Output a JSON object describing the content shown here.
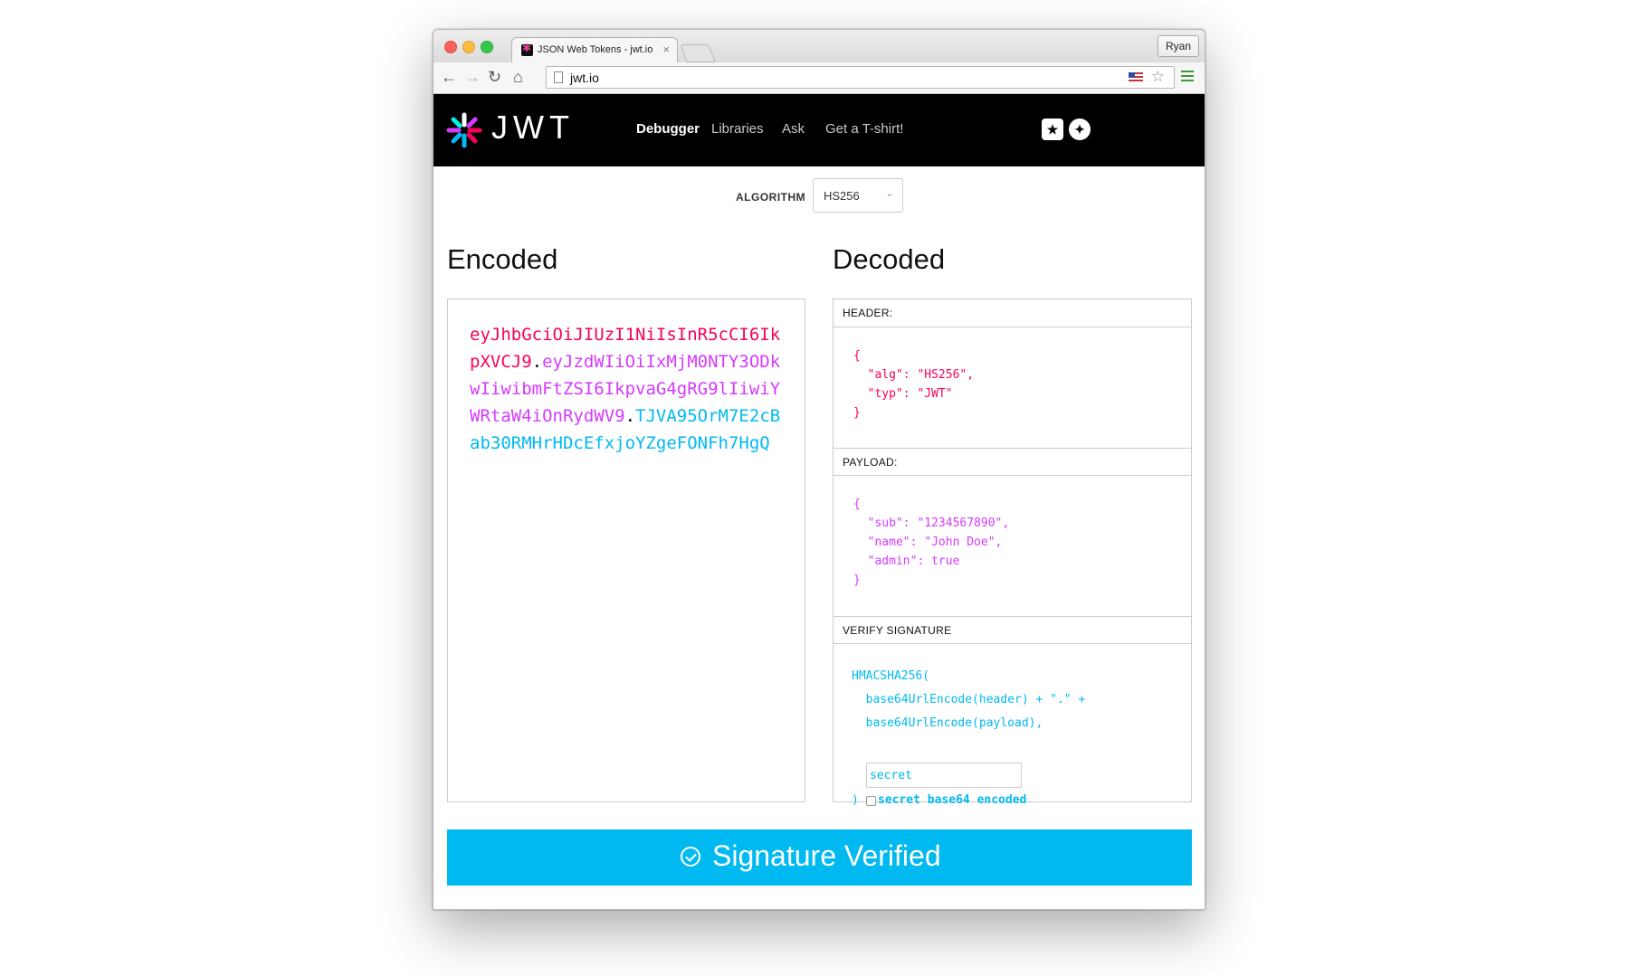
{
  "browser": {
    "tab_title": "JSON Web Tokens - jwt.io",
    "tab_close": "×",
    "profile_name": "Ryan",
    "url": "jwt.io",
    "back": "←",
    "forward": "→",
    "reload": "↻",
    "home": "⌂",
    "star": "☆"
  },
  "header": {
    "logo_text": "JWT",
    "nav": [
      {
        "label": "Debugger",
        "active": true
      },
      {
        "label": "Libraries",
        "active": false
      },
      {
        "label": "Ask",
        "active": false
      },
      {
        "label": "Get a T-shirt!",
        "active": false
      }
    ],
    "icons": [
      "auth0-icon",
      "twitter-icon"
    ]
  },
  "algorithm": {
    "label": "ALGORITHM",
    "selected": "HS256"
  },
  "encoded": {
    "title": "Encoded",
    "header_part": "eyJhbGciOiJIUzI1NiIsInR5cCI6IkpXVCJ9",
    "payload_part": "eyJzdWIiOiIxMjM0NTY3ODkwIiwibmFtZSI6IkpvaG4gRG9lIiwiYWRtaW4iOnRydWV9",
    "signature_part": "TJVA95OrM7E2cBab30RMHrHDcEfxjoYZgeFONFh7HgQ",
    "dot": "."
  },
  "decoded": {
    "title": "Decoded",
    "header_label": "HEADER:",
    "header_json": "{\n  \"alg\": \"HS256\",\n  \"typ\": \"JWT\"\n}",
    "payload_label": "PAYLOAD:",
    "payload_json": "{\n  \"sub\": \"1234567890\",\n  \"name\": \"John Doe\",\n  \"admin\": true\n}",
    "verify_label": "VERIFY SIGNATURE",
    "verify_code": "HMACSHA256(\n  base64UrlEncode(header) + \".\" +\n  base64UrlEncode(payload),",
    "secret_value": "secret",
    "close_paren": ")",
    "b64_label": "secret base64 encoded",
    "b64_checked": false
  },
  "status": {
    "text": "Signature Verified",
    "color": "#00b9f1"
  },
  "colors": {
    "header_part": "#fb015b",
    "payload_part": "#d63aff",
    "signature_part": "#00b9f1"
  }
}
